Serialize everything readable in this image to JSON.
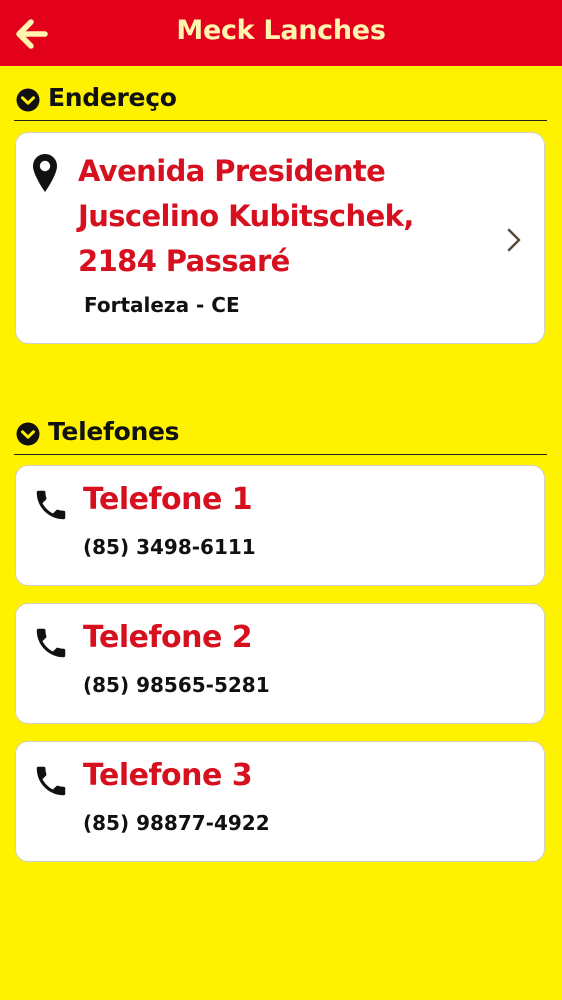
{
  "app_bar": {
    "title": "Meck Lanches",
    "back_icon": "arrow-left-icon"
  },
  "colors": {
    "background": "#FFF200",
    "app_bar": "#E2001A",
    "accent_text": "#D6101E",
    "title_text": "#FFF4B0"
  },
  "address_section": {
    "header": "Endereço",
    "street_lines": [
      "Avenida Presidente",
      "Juscelino Kubitschek,",
      "2184 Passaré"
    ],
    "city": "Fortaleza - CE"
  },
  "phones_section": {
    "header": "Telefones",
    "items": [
      {
        "title": "Telefone 1",
        "number": "(85) 3498-6111"
      },
      {
        "title": "Telefone 2",
        "number": "(85) 98565-5281"
      },
      {
        "title": "Telefone 3",
        "number": "(85) 98877-4922"
      }
    ]
  }
}
